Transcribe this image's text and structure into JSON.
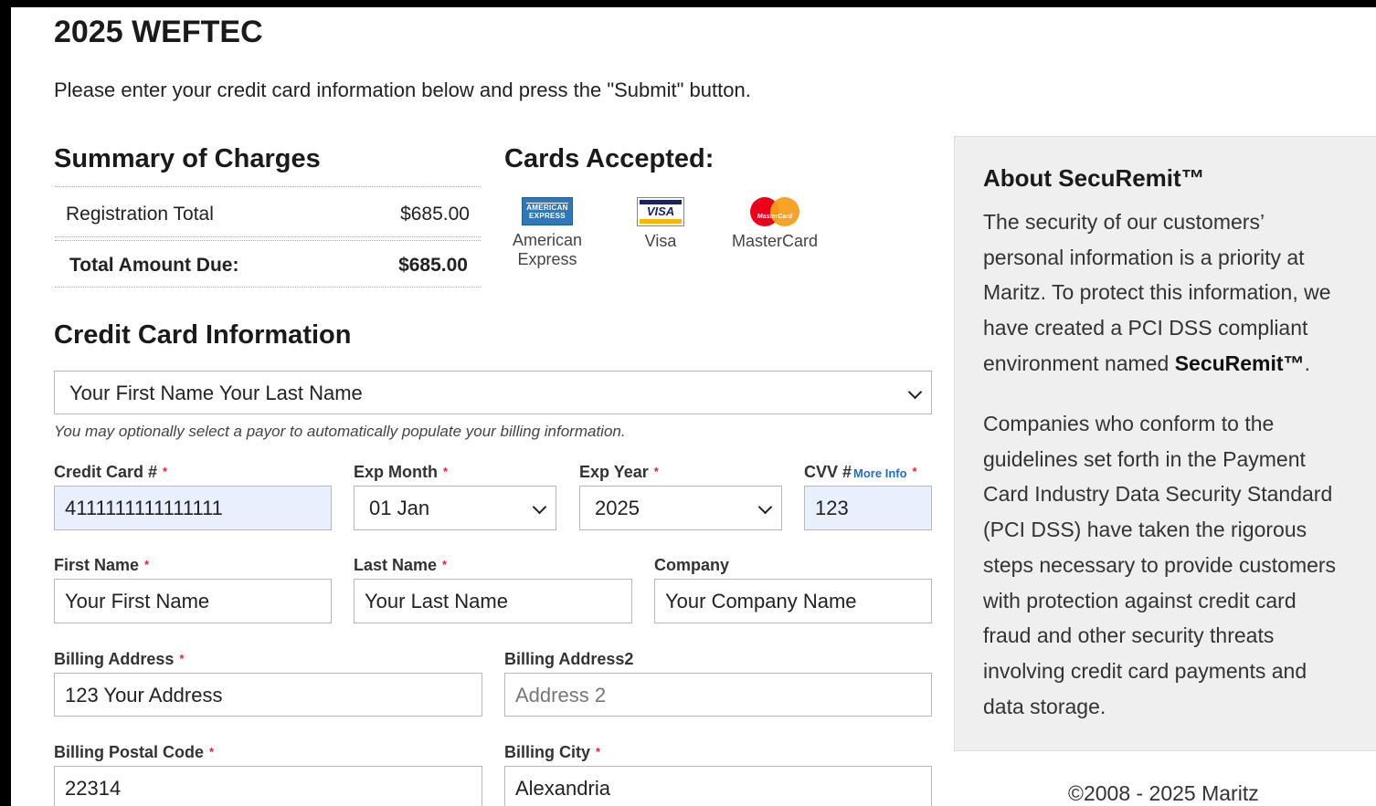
{
  "page": {
    "title": "2025 WEFTEC",
    "intro": "Please enter your credit card information below and press the \"Submit\" button."
  },
  "summary": {
    "heading": "Summary of Charges",
    "rows": [
      {
        "label": "Registration Total",
        "value": "$685.00"
      },
      {
        "label": "Total Amount Due:",
        "value": "$685.00"
      }
    ]
  },
  "cards": {
    "heading": "Cards Accepted:",
    "items": [
      {
        "name": "American Express",
        "line1": "American",
        "line2": "Express",
        "logo_text": "AMERICAN EXPRESS",
        "color": "#2e77bb"
      },
      {
        "name": "Visa",
        "line1": "Visa",
        "line2": "",
        "logo_text": "VISA",
        "color": "#1a1f71"
      },
      {
        "name": "MasterCard",
        "line1": "MasterCard",
        "line2": "",
        "logo_text": "MasterCard",
        "color": "#eb001b"
      }
    ]
  },
  "cc": {
    "heading": "Credit Card Information",
    "payor": {
      "value": "Your First Name Your Last Name"
    },
    "hint": "You may optionally select a payor to automatically populate your billing information.",
    "card_number": {
      "label": "Credit Card #",
      "value": "4111111111111111"
    },
    "exp_month": {
      "label": "Exp Month",
      "value": "01 Jan"
    },
    "exp_year": {
      "label": "Exp Year",
      "value": "2025"
    },
    "cvv": {
      "label": "CVV #",
      "more_info": "More Info",
      "value": "123"
    },
    "first_name": {
      "label": "First Name",
      "value": "Your First Name"
    },
    "last_name": {
      "label": "Last Name",
      "value": "Your Last Name"
    },
    "company": {
      "label": "Company",
      "value": "Your Company Name"
    },
    "address1": {
      "label": "Billing Address",
      "value": "123 Your Address"
    },
    "address2": {
      "label": "Billing Address2",
      "placeholder": "Address 2"
    },
    "postal": {
      "label": "Billing Postal Code",
      "value": "22314"
    },
    "city": {
      "label": "Billing City",
      "value": "Alexandria"
    },
    "required_marker": "*"
  },
  "sidebar": {
    "heading": "About SecuRemit™",
    "p1_lines": [
      "The security of our customers’",
      "personal information is a priority at",
      "Maritz. To protect this information, we",
      "have created a PCI DSS compliant"
    ],
    "p1_last_prefix": "environment named ",
    "p1_last_bold": "SecuRemit™",
    "p1_last_suffix": ".",
    "p2_lines": [
      "Companies who conform to the",
      "guidelines set forth in the Payment",
      "Card Industry Data Security Standard",
      "(PCI DSS) have taken the rigorous",
      "steps necessary to provide customers",
      "with protection against credit card",
      "fraud and other security threats",
      "involving credit card payments and",
      "data storage."
    ]
  },
  "footer": {
    "copyright": "©2008 - 2025 Maritz"
  },
  "colors": {
    "required": "#e0242a",
    "link": "#1f6fc5",
    "autofill": "#e8f0fe",
    "sidebar_bg": "#efefef"
  }
}
